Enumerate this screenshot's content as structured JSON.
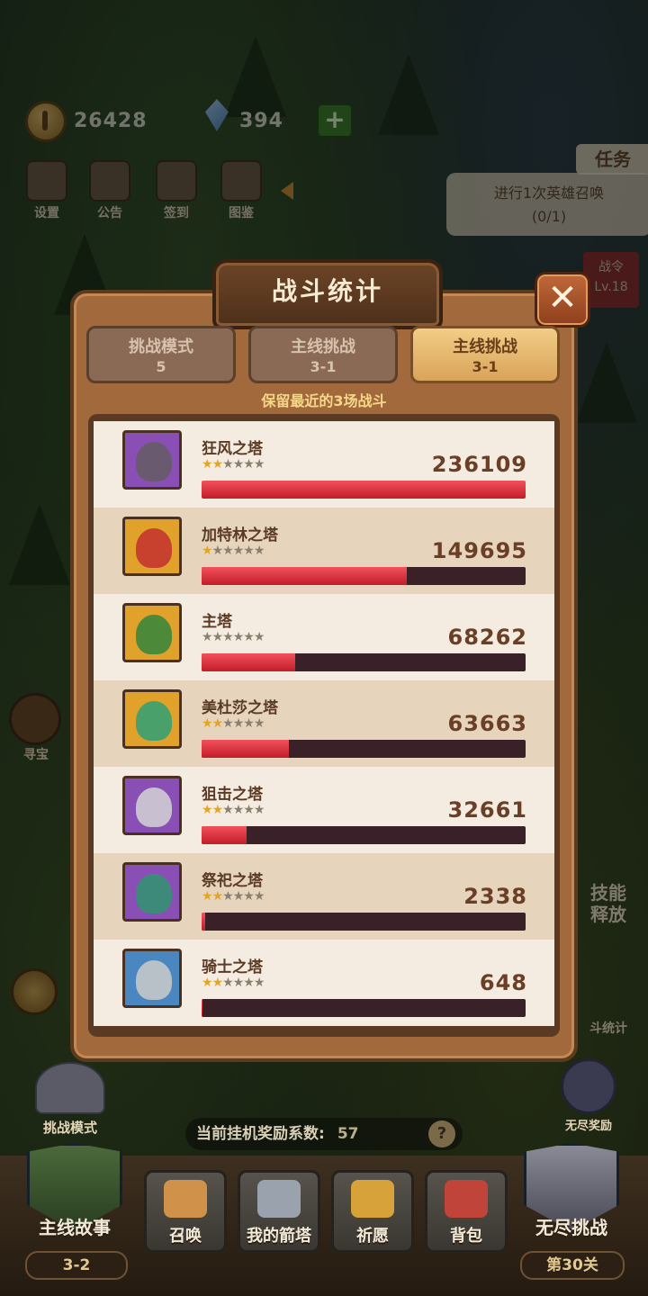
{
  "hud": {
    "coins": "26428",
    "gems": "394",
    "add_label": "+",
    "icons": [
      {
        "label": "设置",
        "icon": "gear-icon"
      },
      {
        "label": "公告",
        "icon": "notice-icon"
      },
      {
        "label": "签到",
        "icon": "checkin-icon"
      },
      {
        "label": "图鉴",
        "icon": "book-icon"
      }
    ]
  },
  "quest": {
    "tab_label": "任务",
    "text": "进行1次英雄召唤",
    "progress": "(0/1)"
  },
  "battle_pass": {
    "label": "战令",
    "level": "Lv.18"
  },
  "side": {
    "treasure_label": "寻宝",
    "skill_label": "技能",
    "skill_label2": "释放",
    "stats_label": "斗统计",
    "challenge_mode_label": "挑战模式",
    "endless_reward_label": "无尽奖励"
  },
  "modal": {
    "title": "战斗统计",
    "close_label": "✕",
    "note": "保留最近的3场战斗",
    "tabs": [
      {
        "name": "挑战模式",
        "sub": "5",
        "active": false
      },
      {
        "name": "主线挑战",
        "sub": "3-1",
        "active": false
      },
      {
        "name": "主线挑战",
        "sub": "3-1",
        "active": true
      }
    ],
    "rows": [
      {
        "name": "狂风之塔",
        "stars": 2,
        "damage": "236109",
        "ratio": 1.0,
        "frame": "#8a4fb5",
        "face": "#6a5a70"
      },
      {
        "name": "加特林之塔",
        "stars": 1,
        "damage": "149695",
        "ratio": 0.634,
        "frame": "#e0a22a",
        "face": "#c8402e"
      },
      {
        "name": "主塔",
        "stars": 0,
        "damage": "68262",
        "ratio": 0.289,
        "frame": "#e0a22a",
        "face": "#4c8a3a"
      },
      {
        "name": "美杜莎之塔",
        "stars": 2,
        "damage": "63663",
        "ratio": 0.27,
        "frame": "#e0a22a",
        "face": "#4aa06a"
      },
      {
        "name": "狙击之塔",
        "stars": 2,
        "damage": "32661",
        "ratio": 0.138,
        "frame": "#8a4fb5",
        "face": "#c8c0d0"
      },
      {
        "name": "祭祀之塔",
        "stars": 2,
        "damage": "2338",
        "ratio": 0.012,
        "frame": "#8a4fb5",
        "face": "#3e8a7a"
      },
      {
        "name": "骑士之塔",
        "stars": 2,
        "damage": "648",
        "ratio": 0.004,
        "frame": "#4a86c0",
        "face": "#b8c0c8"
      }
    ]
  },
  "bottom": {
    "reward_label": "当前挂机奖励系数:",
    "reward_value": "57",
    "help_label": "?",
    "nav": [
      {
        "label": "主线故事",
        "sub": "3-2",
        "icon": "story-book-icon"
      },
      {
        "label": "召唤",
        "icon": "scroll-icon"
      },
      {
        "label": "我的箭塔",
        "icon": "tower-icon"
      },
      {
        "label": "祈愿",
        "icon": "star-wish-icon"
      },
      {
        "label": "背包",
        "icon": "backpack-icon"
      },
      {
        "label": "无尽挑战",
        "sub": "第30关",
        "icon": "sword-shield-icon"
      }
    ]
  }
}
